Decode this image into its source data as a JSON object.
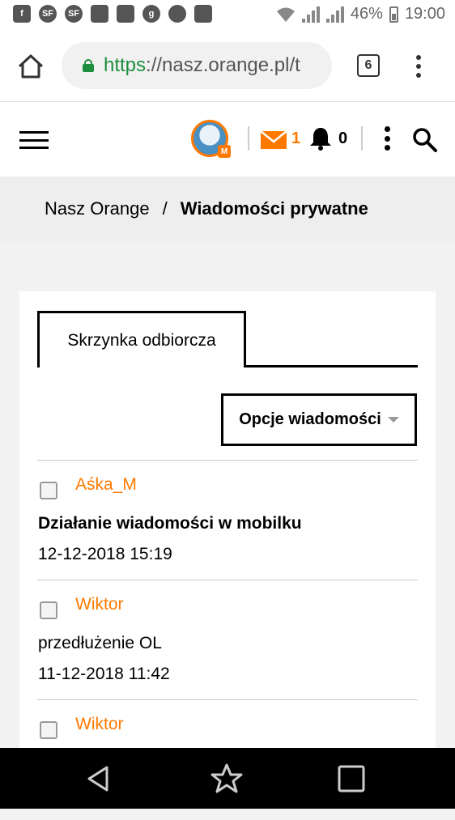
{
  "status_bar": {
    "battery": "46%",
    "time": "19:00",
    "notif_icons": [
      "facebook-icon",
      "sf-icon",
      "sf-icon",
      "app-icon",
      "app-icon",
      "g-icon",
      "messenger-icon",
      "app-icon"
    ]
  },
  "browser": {
    "url_scheme": "https",
    "url_rest": "://nasz.orange.pl/t",
    "tab_count": "6"
  },
  "header": {
    "mail_count": "1",
    "notif_count": "0"
  },
  "breadcrumb": {
    "home": "Nasz Orange",
    "separator": "/",
    "current": "Wiadomości prywatne"
  },
  "inbox": {
    "tab_label": "Skrzynka odbiorcza",
    "options_label": "Opcje wiadomości",
    "messages": [
      {
        "sender": "Aśka_M",
        "subject": "Działanie wiadomości w mobilku",
        "date": "12-12-2018 15:19",
        "unread": true
      },
      {
        "sender": "Wiktor",
        "subject": "przedłużenie OL",
        "date": "11-12-2018 11:42",
        "unread": false
      },
      {
        "sender": "Wiktor",
        "subject": "",
        "date": "",
        "unread": false
      }
    ]
  },
  "colors": {
    "accent": "#ff7900",
    "secure": "#1e8e3e"
  }
}
